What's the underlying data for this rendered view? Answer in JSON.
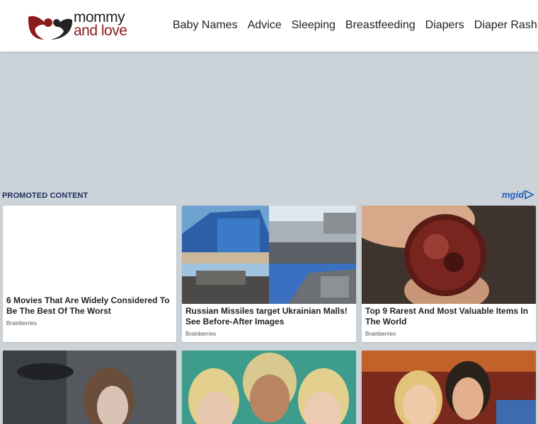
{
  "site": {
    "logo_line1": "mommy",
    "logo_line2": "and love",
    "brand_color": "#8b1a1a"
  },
  "nav": [
    {
      "label": "Baby Names"
    },
    {
      "label": "Advice"
    },
    {
      "label": "Sleeping"
    },
    {
      "label": "Breastfeeding"
    },
    {
      "label": "Diapers"
    },
    {
      "label": "Diaper Rash"
    }
  ],
  "promo": {
    "title": "PROMOTED CONTENT",
    "provider": "mgid"
  },
  "cards": [
    {
      "title": "6 Movies That Are Widely Considered To Be The Best Of The Worst",
      "source": "Brainberries"
    },
    {
      "title": "Russian Missiles target Ukrainian Malls! See Before-After Images",
      "source": "Brainberries"
    },
    {
      "title": "Top 9 Rarest And Most Valuable Items In The World",
      "source": "Brainberries"
    }
  ]
}
